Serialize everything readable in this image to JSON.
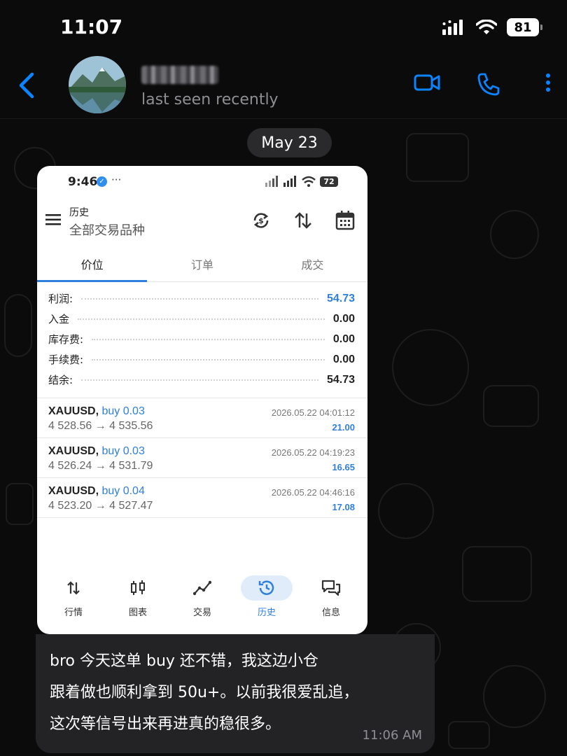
{
  "status_bar": {
    "time": "11:07",
    "battery": "81"
  },
  "header": {
    "status": "last seen recently"
  },
  "date_separator": "May 23",
  "screenshot": {
    "status": {
      "time": "9:46",
      "dots": "···",
      "battery": "72"
    },
    "app_bar": {
      "title_small": "历史",
      "title_big": "全部交易品种"
    },
    "tabs": [
      {
        "label": "价位",
        "active": true
      },
      {
        "label": "订单",
        "active": false
      },
      {
        "label": "成交",
        "active": false
      }
    ],
    "summary": [
      {
        "label": "利润:",
        "value": "54.73",
        "highlight": true
      },
      {
        "label": "入金",
        "value": "0.00",
        "highlight": false
      },
      {
        "label": "库存费:",
        "value": "0.00",
        "highlight": false
      },
      {
        "label": "手续费:",
        "value": "0.00",
        "highlight": false
      },
      {
        "label": "结余:",
        "value": "54.73",
        "highlight": false
      }
    ],
    "deals": [
      {
        "symbol": "XAUUSD,",
        "side": "buy 0.03",
        "prices": "4 528.56 → 4 535.56",
        "time": "2026.05.22 04:01:12",
        "profit": "21.00"
      },
      {
        "symbol": "XAUUSD,",
        "side": "buy 0.03",
        "prices": "4 526.24 → 4 531.79",
        "time": "2026.05.22 04:19:23",
        "profit": "16.65"
      },
      {
        "symbol": "XAUUSD,",
        "side": "buy 0.04",
        "prices": "4 523.20 → 4 527.47",
        "time": "2026.05.22 04:46:16",
        "profit": "17.08"
      }
    ],
    "bottom_nav": [
      {
        "label": "行情",
        "icon": "sort-arrows-icon",
        "active": false
      },
      {
        "label": "图表",
        "icon": "candlestick-icon",
        "active": false
      },
      {
        "label": "交易",
        "icon": "trade-line-icon",
        "active": false
      },
      {
        "label": "历史",
        "icon": "history-clock-icon",
        "active": true
      },
      {
        "label": "信息",
        "icon": "chat-bubbles-icon",
        "active": false
      }
    ]
  },
  "message": {
    "lines": [
      "bro 今天这单 buy 还不错，我这边小仓",
      "跟着做也顺利拿到 50u+。以前我很爱乱追，",
      "这次等信号出来再进真的稳很多。"
    ],
    "time": "11:06 AM"
  },
  "colors": {
    "accent": "#0a84ff",
    "profit_blue": "#2f7fdc",
    "bubble": "#232326",
    "background": "#0b0b0c"
  }
}
